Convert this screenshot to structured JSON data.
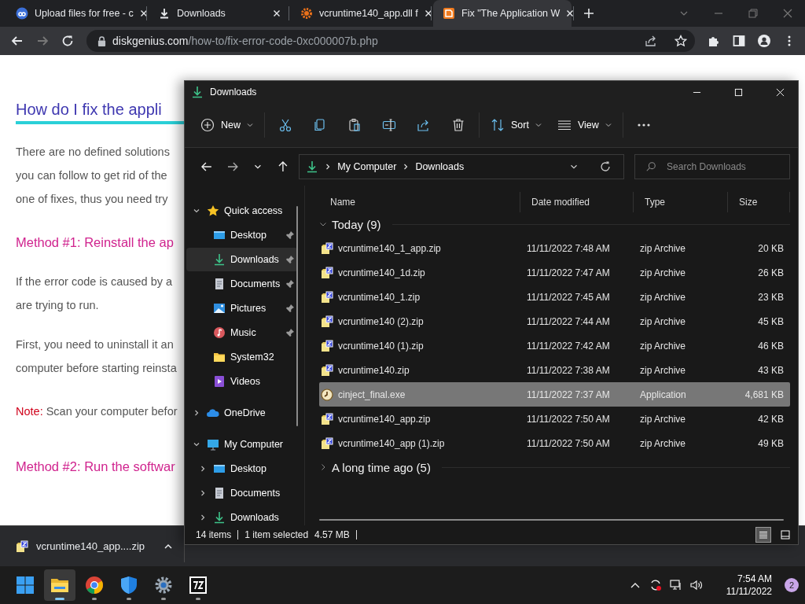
{
  "browser": {
    "tabs": [
      {
        "title": "Upload files for free - c",
        "kind": "cloud",
        "selected": false
      },
      {
        "title": "Downloads",
        "kind": "download",
        "selected": false
      },
      {
        "title": "vcruntime140_app.dll f",
        "kind": "gear",
        "selected": false
      },
      {
        "title": "Fix \"The Application W",
        "kind": "dg",
        "selected": true
      }
    ],
    "address": {
      "domain": "diskgenius.com",
      "path": "/how-to/fix-error-code-0xc000007b.php"
    }
  },
  "article": {
    "blocks": [
      {
        "kind": "heading",
        "lines": [
          "How do I fix the appli"
        ]
      },
      {
        "kind": "text",
        "lines": [
          "There are no defined solutions",
          "you can follow to get rid of the",
          "one of fixes, thus you need try"
        ]
      },
      {
        "kind": "method",
        "lines": [
          "Method #1: Reinstall the ap"
        ]
      },
      {
        "kind": "text",
        "lines": [
          "If the error code is caused by a",
          "are trying to run."
        ]
      },
      {
        "kind": "text",
        "lines": [
          "First, you need to uninstall it an",
          "computer before starting reinsta"
        ]
      },
      {
        "kind": "note",
        "label": "Note:",
        "lines": [
          "Scan your computer befor"
        ]
      },
      {
        "kind": "method",
        "lines": [
          "Method #2: Run the softwar"
        ]
      }
    ]
  },
  "download_bar": {
    "file": "vcruntime140_app....zip"
  },
  "explorer": {
    "title": "Downloads",
    "toolbar": [
      {
        "kind": "new",
        "label": "New"
      },
      {
        "kind": "cut"
      },
      {
        "kind": "copy"
      },
      {
        "kind": "paste"
      },
      {
        "kind": "rename"
      },
      {
        "kind": "share"
      },
      {
        "kind": "delete"
      },
      {
        "kind": "sort",
        "label": "Sort"
      },
      {
        "kind": "view",
        "label": "View"
      },
      {
        "kind": "more"
      }
    ],
    "breadcrumb": [
      "My Computer",
      "Downloads"
    ],
    "search": {
      "placeholder": "Search Downloads"
    },
    "navigation": [
      {
        "label": "Quick access",
        "kind": "star",
        "expanded": true,
        "selected": false,
        "children": [
          {
            "label": "Desktop",
            "kind": "desktop",
            "pinned": true,
            "selected": false
          },
          {
            "label": "Downloads",
            "kind": "download",
            "pinned": true,
            "selected": true
          },
          {
            "label": "Documents",
            "kind": "document",
            "pinned": true,
            "selected": false
          },
          {
            "label": "Pictures",
            "kind": "pictures",
            "pinned": true,
            "selected": false
          },
          {
            "label": "Music",
            "kind": "music",
            "pinned": true,
            "selected": false
          },
          {
            "label": "System32",
            "kind": "folder",
            "pinned": false,
            "selected": false
          },
          {
            "label": "Videos",
            "kind": "videos",
            "pinned": false,
            "selected": false
          }
        ]
      },
      {
        "label": "OneDrive",
        "kind": "cloud",
        "expanded": false,
        "selected": false
      },
      {
        "label": "My Computer",
        "kind": "computer",
        "expanded": true,
        "selected": false,
        "children": [
          {
            "label": "Desktop",
            "kind": "desktop",
            "expanded": false,
            "selected": false
          },
          {
            "label": "Documents",
            "kind": "document",
            "expanded": false,
            "selected": false
          },
          {
            "label": "Downloads",
            "kind": "download",
            "expanded": false,
            "selected": false
          }
        ]
      }
    ],
    "columns": [
      "Name",
      "Date modified",
      "Type",
      "Size"
    ],
    "groups": [
      {
        "label": "Today (9)",
        "expanded": true,
        "files": [
          {
            "name": "vcruntime140_1_app.zip",
            "date": "11/11/2022 7:48 AM",
            "type": "zip Archive",
            "size": "20 KB",
            "kind": "zip",
            "selected": false
          },
          {
            "name": "vcruntime140_1d.zip",
            "date": "11/11/2022 7:47 AM",
            "type": "zip Archive",
            "size": "26 KB",
            "kind": "zip",
            "selected": false
          },
          {
            "name": "vcruntime140_1.zip",
            "date": "11/11/2022 7:45 AM",
            "type": "zip Archive",
            "size": "23 KB",
            "kind": "zip",
            "selected": false
          },
          {
            "name": "vcruntime140 (2).zip",
            "date": "11/11/2022 7:44 AM",
            "type": "zip Archive",
            "size": "45 KB",
            "kind": "zip",
            "selected": false
          },
          {
            "name": "vcruntime140 (1).zip",
            "date": "11/11/2022 7:42 AM",
            "type": "zip Archive",
            "size": "46 KB",
            "kind": "zip",
            "selected": false
          },
          {
            "name": "vcruntime140.zip",
            "date": "11/11/2022 7:38 AM",
            "type": "zip Archive",
            "size": "43 KB",
            "kind": "zip",
            "selected": false
          },
          {
            "name": "cinject_final.exe",
            "date": "11/11/2022 7:37 AM",
            "type": "Application",
            "size": "4,681 KB",
            "kind": "exe",
            "selected": true
          },
          {
            "name": "vcruntime140_app.zip",
            "date": "11/11/2022 7:50 AM",
            "type": "zip Archive",
            "size": "42 KB",
            "kind": "zip",
            "selected": false
          },
          {
            "name": "vcruntime140_app (1).zip",
            "date": "11/11/2022 7:50 AM",
            "type": "zip Archive",
            "size": "49 KB",
            "kind": "zip",
            "selected": false
          }
        ]
      },
      {
        "label": "A long time ago (5)",
        "expanded": false
      }
    ],
    "status": {
      "items": "14 items",
      "selection": "1 item selected",
      "size": "4.57 MB"
    },
    "views": [
      {
        "kind": "details",
        "selected": true
      },
      {
        "kind": "tiles",
        "selected": false
      }
    ]
  },
  "taskbar": {
    "apps": [
      {
        "kind": "start",
        "running": false,
        "selected": false
      },
      {
        "kind": "explorer",
        "running": true,
        "selected": true
      },
      {
        "kind": "chrome",
        "running": true,
        "selected": false
      },
      {
        "kind": "shield",
        "running": true,
        "selected": false
      },
      {
        "kind": "settings",
        "running": true,
        "selected": false
      },
      {
        "kind": "archiver",
        "running": true,
        "selected": false
      }
    ],
    "time": "7:54 AM",
    "date": "11/11/2022",
    "notifications": "2"
  }
}
